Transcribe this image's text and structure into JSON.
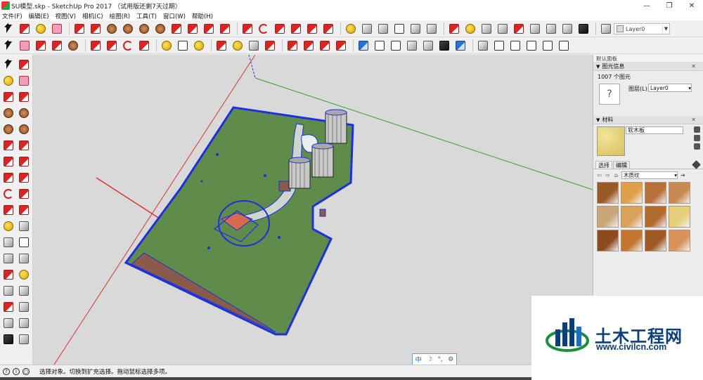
{
  "window": {
    "title": "SU模型.skp - SketchUp Pro 2017 （试用版还剩7天过期）",
    "controls": [
      "—",
      "❐",
      "✕"
    ]
  },
  "menu": [
    "文件(F)",
    "编辑(E)",
    "视图(V)",
    "相机(C)",
    "绘图(R)",
    "工具(T)",
    "窗口(W)",
    "帮助(H)"
  ],
  "toolbar": {
    "layer_selector": "Layer0"
  },
  "panel": {
    "tray_title": "默认面板",
    "entity_info": {
      "header": "图元信息",
      "count": "1007 个图元",
      "layer_label": "图层(L):",
      "layer_value": "Layer0",
      "preview_glyph": "?"
    },
    "materials": {
      "header": "材料",
      "current_name": "软木板",
      "tabs": [
        "选择",
        "编辑"
      ],
      "collection": "木质纹",
      "swatches": [
        "#9a5a26",
        "#e0a04a",
        "#b8703a",
        "#c88a52",
        "#c8a678",
        "#d9a25a",
        "#b06a2e",
        "#e6d07a",
        "#8a4a1e",
        "#c2762e",
        "#9e5a24",
        "#d8925a"
      ]
    }
  },
  "status": {
    "text": "选择对象。切换到扩充选择。拖动鼠标选择多项。"
  },
  "ime": {
    "lang": "中",
    "moon": "☽",
    "punct": "°,",
    "gear": "⚙"
  },
  "watermark": {
    "name": "土木工程网",
    "url": "www.civilcn.com"
  },
  "colors": {
    "viewport_bg": "#d9d9d9",
    "site_green": "#5f8c4a",
    "selection_blue": "#1e2fe0",
    "axis_red": "#e23030",
    "axis_green": "#2aa52a",
    "axis_blue": "#2a3ad0"
  }
}
